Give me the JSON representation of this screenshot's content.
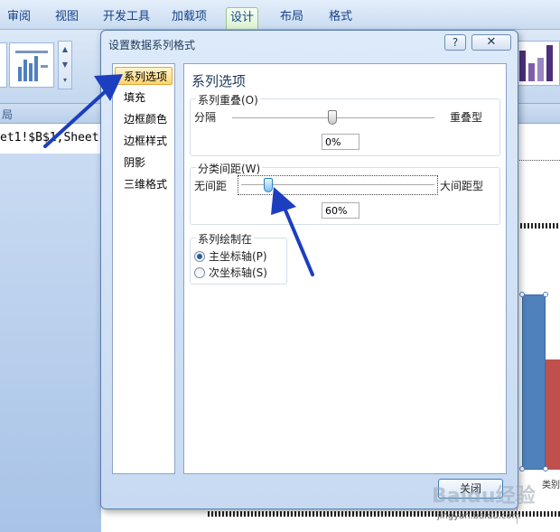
{
  "ribbon": {
    "tabs": [
      {
        "label": "审阅"
      },
      {
        "label": "视图"
      },
      {
        "label": "开发工具"
      },
      {
        "label": "加载项"
      },
      {
        "label": "设计"
      },
      {
        "label": "布局"
      },
      {
        "label": "格式"
      }
    ],
    "active_tab": "设计",
    "group_label_left": "局"
  },
  "formula_bar": {
    "text": "et1!$B$1,Sheet1"
  },
  "chart": {
    "category_label": "类别",
    "colors": {
      "series1": "#4f81bd",
      "series2": "#c0504d"
    }
  },
  "dialog": {
    "title": "设置数据系列格式",
    "help_label": "?",
    "close_x_label": "✕",
    "nav_items": [
      {
        "label": "系列选项",
        "selected": true
      },
      {
        "label": "填充",
        "selected": false
      },
      {
        "label": "边框颜色",
        "selected": false
      },
      {
        "label": "边框样式",
        "selected": false
      },
      {
        "label": "阴影",
        "selected": false
      },
      {
        "label": "三维格式",
        "selected": false
      }
    ],
    "section_title": "系列选项",
    "series_overlap": {
      "label": "系列重叠(O)",
      "left_label": "分隔",
      "right_label": "重叠型",
      "value": "0%",
      "level": 0
    },
    "gap_width": {
      "label": "分类间距(W)",
      "left_label": "无间距",
      "right_label": "大间距型",
      "value": "60%",
      "level": 60
    },
    "plot_on": {
      "label": "系列绘制在",
      "options": [
        {
          "label": "主坐标轴(P)",
          "checked": true
        },
        {
          "label": "次坐标轴(S)",
          "checked": false
        }
      ]
    },
    "close_button_label": "关闭"
  },
  "watermark": {
    "text": "Baidu经验",
    "subtext": "jingyan.baidu.com"
  }
}
